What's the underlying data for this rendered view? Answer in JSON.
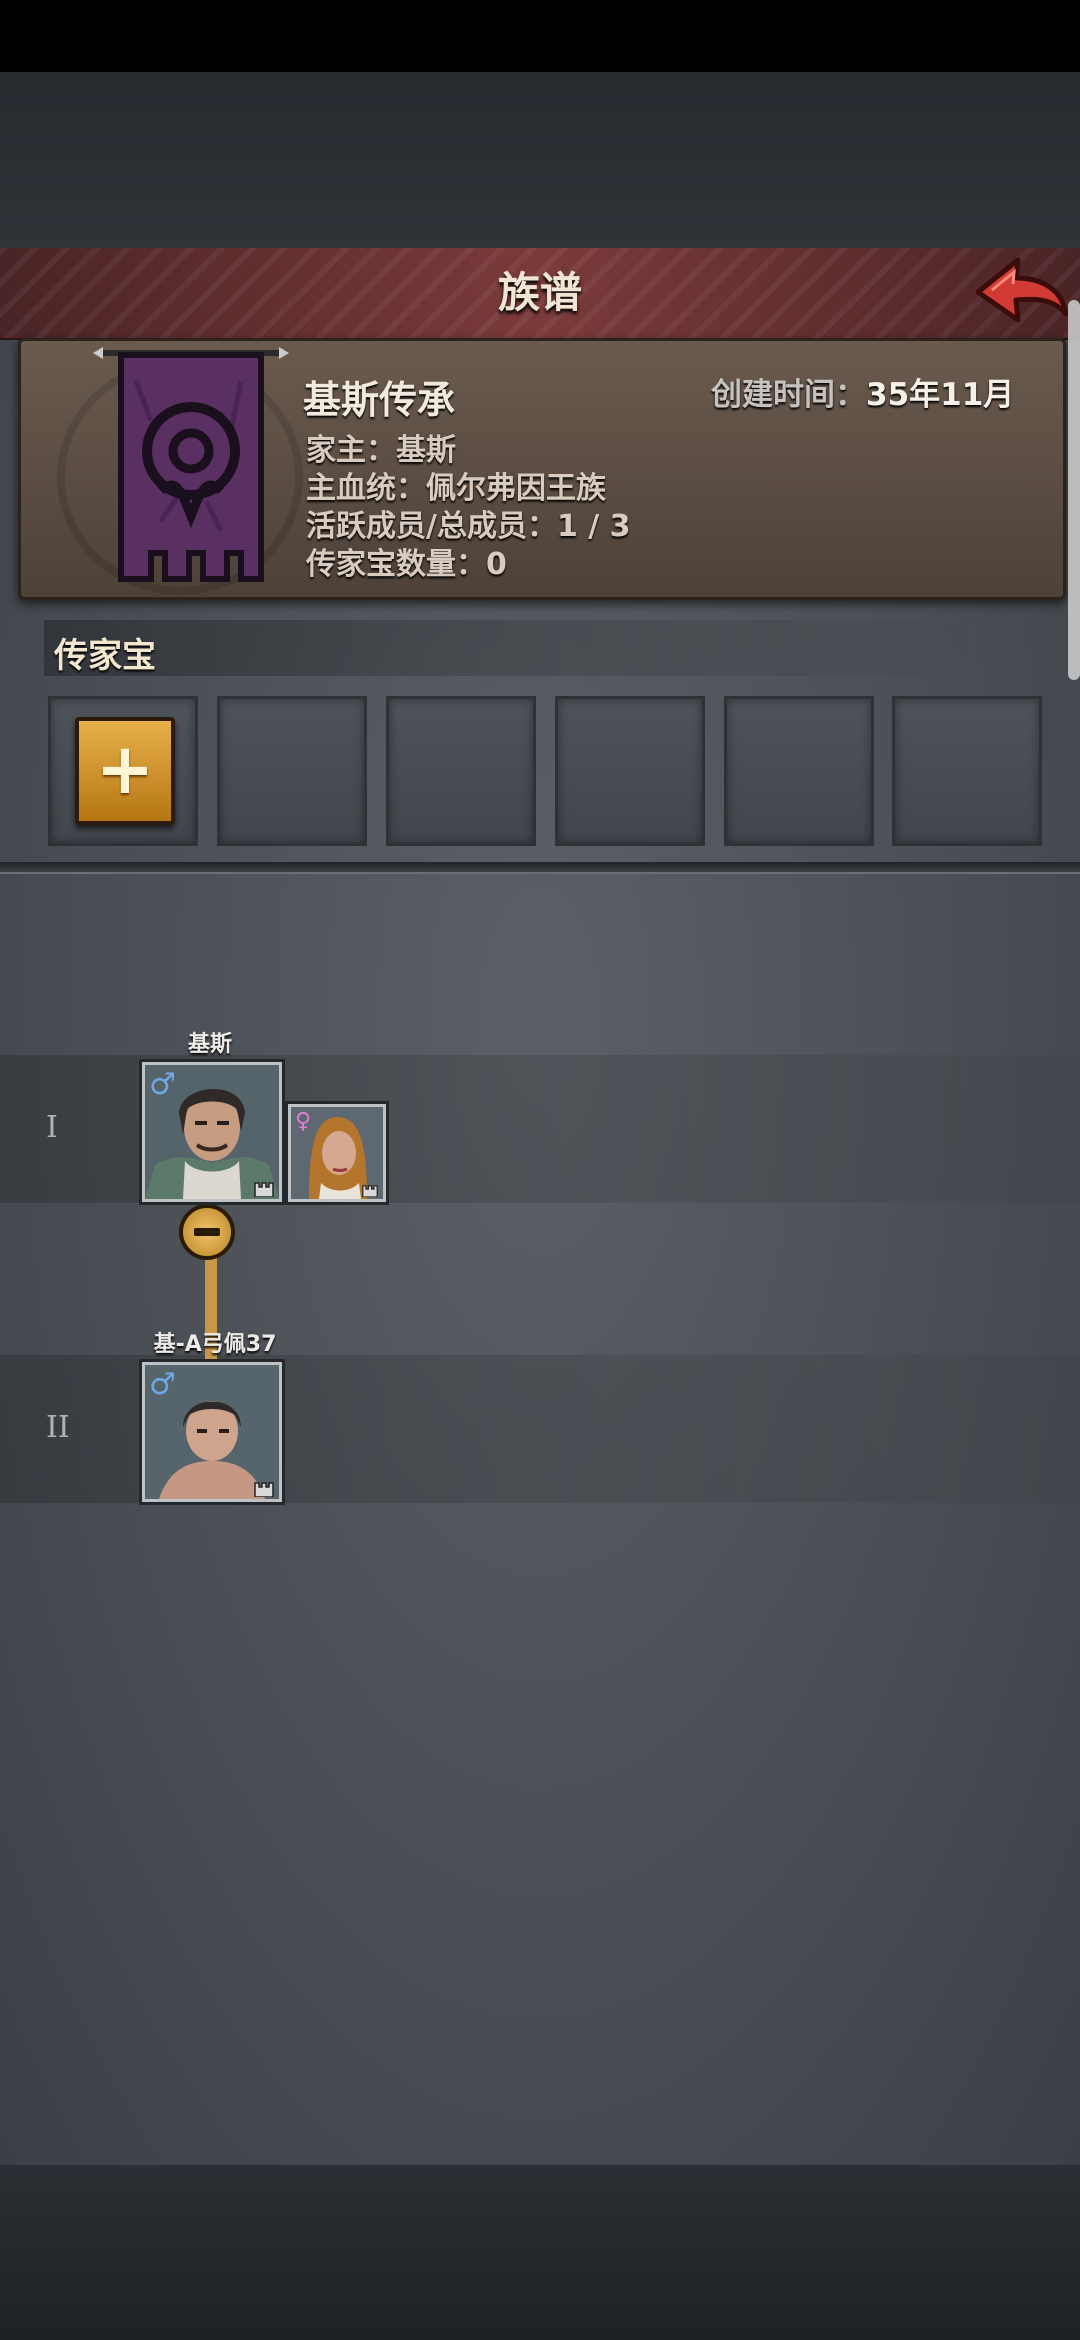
{
  "header": {
    "title": "族谱"
  },
  "family": {
    "name": "基斯传承",
    "created_label": "创建时间：",
    "created_value": "35年11月",
    "head_line": "家主：基斯",
    "bloodline_line": "主血统：佩尔弗因王族",
    "members_line": "活跃成员/总成员：1 / 3",
    "heirloom_count_line": "传家宝数量：0"
  },
  "heirloom": {
    "title": "传家宝",
    "add_label": "+"
  },
  "tree": {
    "generations": [
      {
        "label": "I"
      },
      {
        "label": "II"
      }
    ],
    "members": [
      {
        "name": "基斯",
        "gender": "♂"
      },
      {
        "name": "",
        "gender": "♀"
      },
      {
        "name": "基-A弓佩37",
        "gender": "♂"
      }
    ]
  },
  "icons": [
    "back-arrow-icon",
    "clan-banner-icon",
    "plus-icon",
    "minus-icon",
    "male-icon",
    "female-icon",
    "tower-icon"
  ],
  "colors": {
    "title_bar": "#7b3a3a",
    "accent_gold": "#c89846",
    "male": "#6fa6e6",
    "female": "#e27ed2"
  }
}
